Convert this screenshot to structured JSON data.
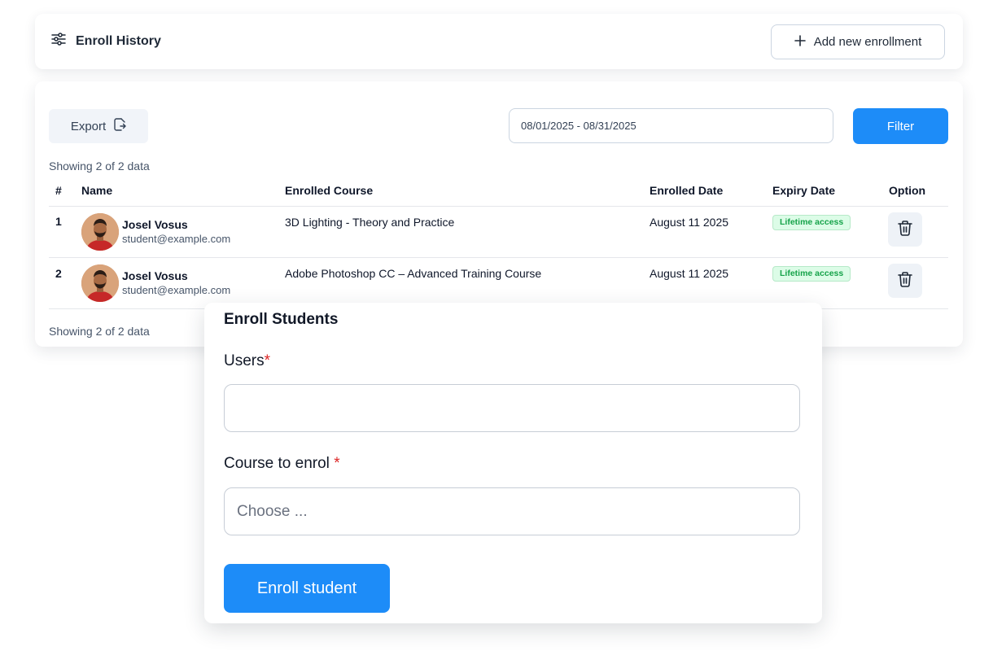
{
  "header": {
    "title": "Enroll History",
    "add_button_label": "Add new enrollment"
  },
  "toolbar": {
    "export_label": "Export",
    "date_range": "08/01/2025 - 08/31/2025",
    "filter_label": "Filter"
  },
  "table": {
    "showing_top": "Showing 2 of 2 data",
    "showing_bottom": "Showing 2 of 2 data",
    "columns": [
      "#",
      "Name",
      "Enrolled Course",
      "Enrolled Date",
      "Expiry Date",
      "Option"
    ],
    "rows": [
      {
        "num": "1",
        "name": "Josel Vosus",
        "email": "student@example.com",
        "course": "3D Lighting - Theory and Practice",
        "enrolled_date": "August 11 2025",
        "expiry": "Lifetime access"
      },
      {
        "num": "2",
        "name": "Josel Vosus",
        "email": "student@example.com",
        "course": "Adobe Photoshop CC – Advanced Training Course",
        "enrolled_date": "August 11 2025",
        "expiry": "Lifetime access"
      }
    ]
  },
  "modal": {
    "title": "Enroll Students",
    "users_label": "Users",
    "users_value": "",
    "course_label": "Course to enrol",
    "course_placeholder": "Choose ...",
    "required_mark": "*",
    "submit_label": "Enroll student"
  },
  "colors": {
    "primary": "#1d8cf8",
    "badge_green": "#16a34a",
    "required_red": "#dc2626"
  }
}
